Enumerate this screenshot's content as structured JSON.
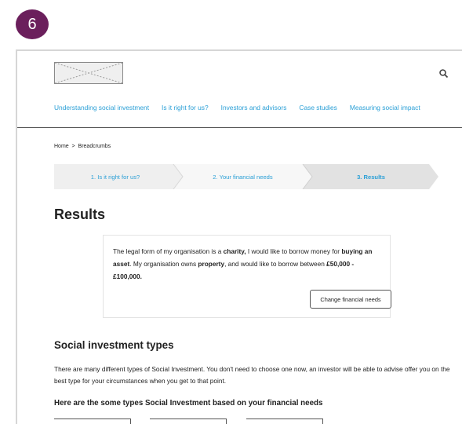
{
  "badge": {
    "number": "6",
    "color": "#6b1f5c"
  },
  "header": {
    "logo": "placeholder-image",
    "search_icon": "search-icon",
    "nav": [
      "Understanding social investment",
      "Is it right for us?",
      "Investors and advisors",
      "Case studies",
      "Measuring social impact"
    ]
  },
  "breadcrumb": "Home  >  Breadcrumbs",
  "steps": [
    {
      "label": "1. Is it right for us?",
      "active": false
    },
    {
      "label": "2. Your financial needs",
      "active": false
    },
    {
      "label": "3. Results",
      "active": true
    }
  ],
  "results": {
    "title": "Results",
    "summary": {
      "t1": "The legal form of my organisation is a ",
      "b1": "charity,",
      "t2": " I would like to borrow money for ",
      "b2": "buying an asset",
      "t3": ". My organisation owns ",
      "b3": "property",
      "t4": ", and would like to borrow between ",
      "b4": "£50,000 - £100,000."
    },
    "change_button": "Change financial needs"
  },
  "types": {
    "title": "Social investment types",
    "description": "There are many different types of Social Investment.  You don't need to choose one now, an investor will be able to advise offer you on the best type for your circumstances when you get to that point.",
    "subtitle": "Here are the some types Social Investment based on your financial needs"
  },
  "colors": {
    "link": "#2a9fd6",
    "step_bg": "#efefef",
    "step_active_bg": "#e2e2e2"
  }
}
